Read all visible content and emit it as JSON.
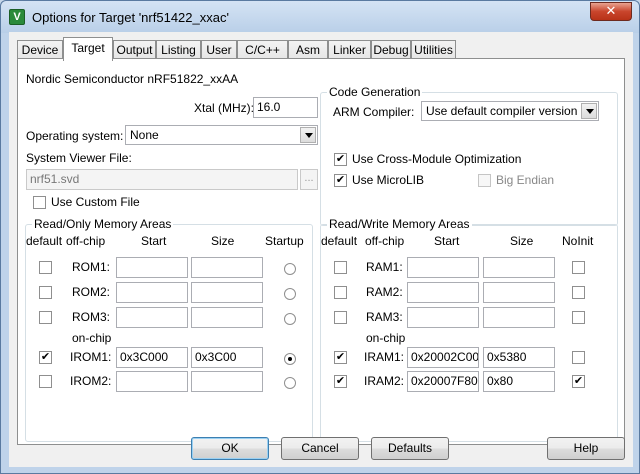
{
  "window": {
    "title": "Options for Target 'nrf51422_xxac'",
    "close_glyph": "✕",
    "icon_letter": "V"
  },
  "tabs": [
    "Device",
    "Target",
    "Output",
    "Listing",
    "User",
    "C/C++",
    "Asm",
    "Linker",
    "Debug",
    "Utilities"
  ],
  "active_tab": "Target",
  "target": {
    "device_name": "Nordic Semiconductor nRF51822_xxAA",
    "xtal_label": "Xtal (MHz):",
    "xtal_value": "16.0",
    "os_label": "Operating system:",
    "os_value": "None",
    "svf_label": "System Viewer File:",
    "svf_value": "nrf51.svd",
    "browse_label": "...",
    "custom_file_label": "Use Custom File",
    "custom_file_checked": false
  },
  "code_generation": {
    "title": "Code Generation",
    "compiler_label": "ARM Compiler:",
    "compiler_value": "Use default compiler version",
    "cross_module_label": "Use Cross-Module Optimization",
    "cross_module_checked": true,
    "microlib_label": "Use MicroLIB",
    "microlib_checked": true,
    "big_endian_label": "Big Endian",
    "big_endian_checked": false
  },
  "ro_memory": {
    "title": "Read/Only Memory Areas",
    "headers": {
      "default": "default",
      "offchip": "off-chip",
      "start": "Start",
      "size": "Size",
      "startup": "Startup"
    },
    "onchip_label": "on-chip",
    "rows": [
      {
        "name": "ROM1:",
        "default": false,
        "start": "",
        "size": "",
        "startup": false
      },
      {
        "name": "ROM2:",
        "default": false,
        "start": "",
        "size": "",
        "startup": false
      },
      {
        "name": "ROM3:",
        "default": false,
        "start": "",
        "size": "",
        "startup": false
      },
      {
        "name": "IROM1:",
        "default": true,
        "start": "0x3C000",
        "size": "0x3C00",
        "startup": true
      },
      {
        "name": "IROM2:",
        "default": false,
        "start": "",
        "size": "",
        "startup": false
      }
    ]
  },
  "rw_memory": {
    "title": "Read/Write Memory Areas",
    "headers": {
      "default": "default",
      "offchip": "off-chip",
      "start": "Start",
      "size": "Size",
      "noinit": "NoInit"
    },
    "onchip_label": "on-chip",
    "rows": [
      {
        "name": "RAM1:",
        "default": false,
        "start": "",
        "size": "",
        "noinit": false
      },
      {
        "name": "RAM2:",
        "default": false,
        "start": "",
        "size": "",
        "noinit": false
      },
      {
        "name": "RAM3:",
        "default": false,
        "start": "",
        "size": "",
        "noinit": false
      },
      {
        "name": "IRAM1:",
        "default": true,
        "start": "0x20002C00",
        "size": "0x5380",
        "noinit": false
      },
      {
        "name": "IRAM2:",
        "default": true,
        "start": "0x20007F80",
        "size": "0x80",
        "noinit": true
      }
    ]
  },
  "buttons": {
    "ok": "OK",
    "cancel": "Cancel",
    "defaults": "Defaults",
    "help": "Help"
  },
  "check_glyph": "✔"
}
